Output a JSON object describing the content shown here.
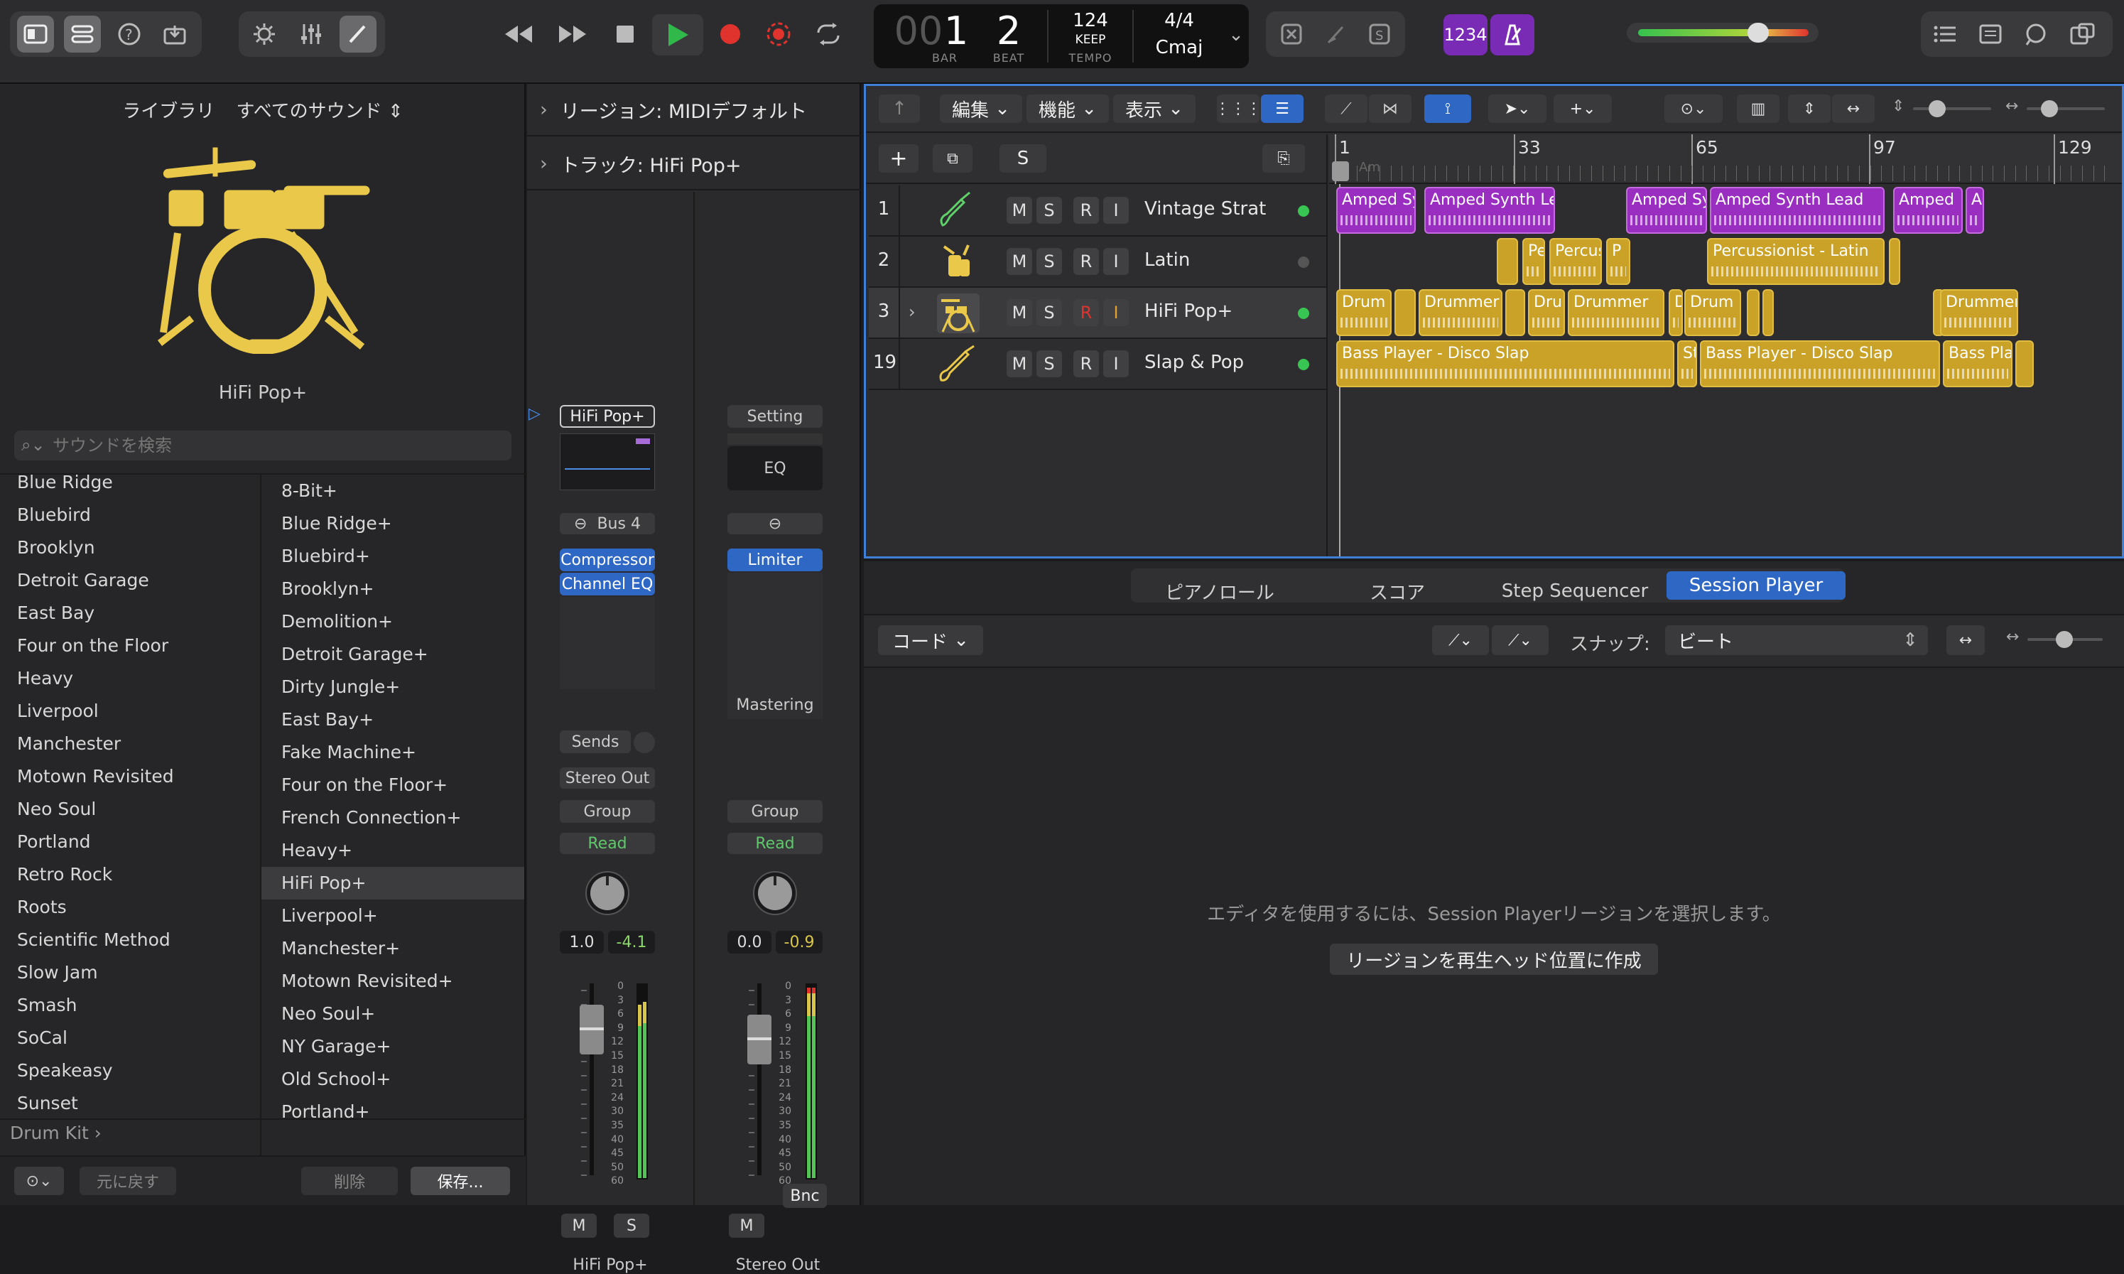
{
  "toolbar": {
    "lcd": {
      "bar_value": "1",
      "bar_prefix": "00",
      "beat_value": "2",
      "bar_label": "BAR",
      "beat_label": "BEAT",
      "tempo_value": "124",
      "tempo_mode": "KEEP",
      "tempo_label": "TEMPO",
      "signature": "4/4",
      "key": "Cmaj"
    },
    "count_in_label": "1234",
    "accent_color": "#7a2bb5",
    "play_color": "#30b94a",
    "record_color": "#e0332e"
  },
  "library": {
    "title": "ライブラリ",
    "scope": "すべてのサウンド",
    "patch_name": "HiFi Pop+",
    "search_placeholder": "サウンドを検索",
    "left_items": [
      "Blue Ridge",
      "Bluebird",
      "Brooklyn",
      "Detroit Garage",
      "East Bay",
      "Four on the Floor",
      "Heavy",
      "Liverpool",
      "Manchester",
      "Motown Revisited",
      "Neo Soul",
      "Portland",
      "Retro Rock",
      "Roots",
      "Scientific Method",
      "Slow Jam",
      "Smash",
      "SoCal",
      "Speakeasy",
      "Sunset"
    ],
    "right_items": [
      "8-Bit+",
      "Blue Ridge+",
      "Bluebird+",
      "Brooklyn+",
      "Demolition+",
      "Detroit Garage+",
      "Dirty Jungle+",
      "East Bay+",
      "Fake Machine+",
      "Four on the Floor+",
      "French Connection+",
      "Heavy+",
      "HiFi Pop+",
      "Liverpool+",
      "Manchester+",
      "Motown Revisited+",
      "Neo Soul+",
      "NY Garage+",
      "Old School+",
      "Portland+"
    ],
    "selected_right": "HiFi Pop+",
    "footer_path": "Drum Kit",
    "revert_label": "元に戻す",
    "delete_label": "削除",
    "save_label": "保存..."
  },
  "inspector": {
    "region_header": "リージョン: MIDIデフォルト",
    "track_header": "トラック: HiFi Pop+",
    "strip1": {
      "name_button": "HiFi Pop+",
      "bus": "Bus 4",
      "plugins": [
        "Compressor",
        "Channel EQ"
      ],
      "sends": "Sends",
      "output": "Stereo Out",
      "group": "Group",
      "automation": "Read",
      "pan": "1.0",
      "gain": "-4.1",
      "mute": "M",
      "solo": "S",
      "label": "HiFi Pop+"
    },
    "strip2": {
      "setting": "Setting",
      "eq": "EQ",
      "plugins": [
        "Limiter"
      ],
      "mastering": "Mastering",
      "group": "Group",
      "automation": "Read",
      "pan": "0.0",
      "gain": "-0.9",
      "mute": "M",
      "bnc": "Bnc",
      "label": "Stereo Out"
    },
    "meter_scale": [
      "0",
      "3",
      "6",
      "9",
      "12",
      "15",
      "18",
      "21",
      "24",
      "30",
      "35",
      "40",
      "45",
      "50",
      "60"
    ]
  },
  "tracks_area": {
    "menus": [
      "編集",
      "機能",
      "表示"
    ],
    "ruler": [
      "1",
      "33",
      "65",
      "97",
      "129"
    ],
    "ruler_chord": "Am",
    "tracks": [
      {
        "num": "1",
        "name": "Vintage Strat",
        "icon": "guitar-icon",
        "led": "#39c553"
      },
      {
        "num": "2",
        "name": "Latin",
        "icon": "percussion-icon",
        "led": "#555555"
      },
      {
        "num": "3",
        "name": "HiFi Pop+",
        "icon": "drumkit-icon",
        "led": "#39c553"
      },
      {
        "num": "19",
        "name": "Slap & Pop",
        "icon": "bass-icon",
        "led": "#39c553"
      }
    ],
    "regions_row1": [
      "Amped Sy",
      "Amped Synth Lead",
      "Amped Sy",
      "Amped Synth Lead",
      "Amped",
      "A"
    ],
    "regions_row2": [
      "Perc",
      "Percussio",
      "P",
      "Percussionist - Latin"
    ],
    "regions_row3": [
      "Drum",
      "Drummer",
      "Dru",
      "Drummer",
      "D",
      "Drum",
      "Drummer"
    ],
    "regions_row4": [
      "Bass Player - Disco Slap",
      "St",
      "Bass Player - Disco Slap",
      "Bass Playe"
    ]
  },
  "editor": {
    "tabs": [
      "ピアノロール",
      "スコア",
      "Step Sequencer",
      "Session Player"
    ],
    "active_tab": "Session Player",
    "chord_menu": "コード",
    "snap_label": "スナップ:",
    "snap_value": "ビート",
    "empty_message": "エディタを使用するには、Session Playerリージョンを選択します。",
    "create_button": "リージョンを再生ヘッド位置に作成"
  }
}
